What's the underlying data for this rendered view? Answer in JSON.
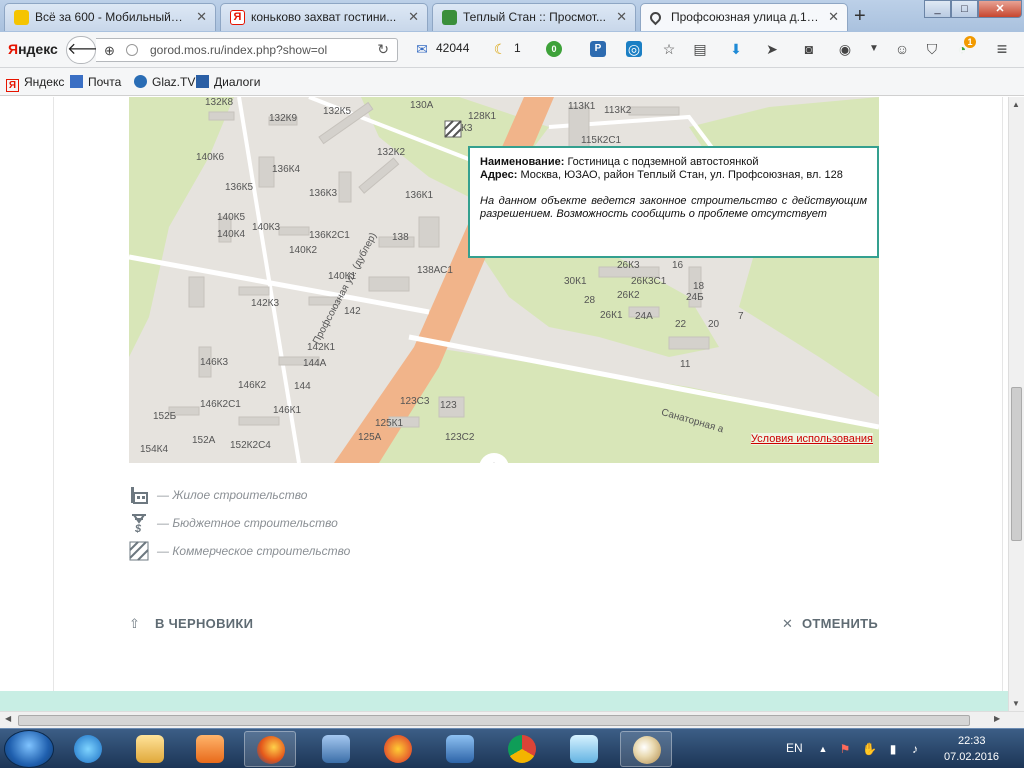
{
  "browser": {
    "tabs": [
      {
        "title": "Всё за 600 - Мобильный ...",
        "favicon_color": "#f5c400",
        "active": false
      },
      {
        "title": "коньково захват гостини...",
        "favicon_color": "#e61400",
        "active": false
      },
      {
        "title": "Теплый Стан :: Просмот...",
        "favicon_color": "#3a8f3a",
        "active": false
      },
      {
        "title": "Профсоюзная улица д.12...",
        "favicon_color": "#444444",
        "active": true
      }
    ],
    "new_tab_label": "+",
    "window_controls": {
      "minimize": "_",
      "maximize": "□",
      "close": "✕"
    },
    "brand": {
      "first": "Я",
      "rest": "ндекс"
    },
    "url": "gorod.mos.ru/index.php?show=ol",
    "mail_count": "42044",
    "moon_count": "1",
    "green_badge": "0",
    "sync_badge": "1"
  },
  "bookmarks": [
    {
      "label": "Яндекс",
      "icon": "yandex-icon",
      "color": "#e61400"
    },
    {
      "label": "Почта",
      "icon": "mail-icon",
      "color": "#3a6fc4"
    },
    {
      "label": "Glaz.TV",
      "icon": "tv-icon",
      "color": "#2a6db5"
    },
    {
      "label": "Диалоги",
      "icon": "chat-icon",
      "color": "#2a5fa5"
    }
  ],
  "map": {
    "labels": [
      "132К8",
      "132К9",
      "132К5",
      "130А",
      "128К1",
      "113К1",
      "113К2",
      "К3",
      "140К6",
      "136К4",
      "132К2",
      "115К2С1",
      "136К5",
      "136К3",
      "136К1",
      "140К5",
      "140К3",
      "136К2С1",
      "138",
      "140К4",
      "140К2",
      "140К1",
      "138АС1",
      "142К3",
      "142",
      "26К3",
      "30К1",
      "26К3С1",
      "26К2",
      "24Б",
      "28",
      "18",
      "26К1",
      "24А",
      "22",
      "20",
      "7",
      "16",
      "142К1",
      "146К3",
      "144А",
      "144",
      "146К2",
      "146К2С1",
      "146К1",
      "152Б",
      "152А",
      "152К2С4",
      "154К4",
      "123С3",
      "123",
      "125К1",
      "125А",
      "123С2",
      "11"
    ],
    "street_main": "Профсоюзная ул. (дублер)",
    "street_side": "Санаторная а",
    "terms_link": "Условия использования",
    "collapse_label": "︿"
  },
  "popup": {
    "name_label": "Наименование:",
    "name_value": "Гостиница с подземной автостоянкой",
    "address_label": "Адрес:",
    "address_value": "Москва, ЮЗАО, район Теплый Стан, ул. Профсоюзная, вл. 128",
    "note": "На данном объекте ведется законное строительство с действующим разрешением. Возможность сообщить о проблеме отсутствует"
  },
  "legend": [
    {
      "text": "— Жилое строительство",
      "icon": "residential-icon"
    },
    {
      "text": "— Бюджетное строительство",
      "icon": "budget-icon"
    },
    {
      "text": "— Коммерческое строительство",
      "icon": "commercial-icon"
    }
  ],
  "actions": {
    "drafts": "В ЧЕРНОВИКИ",
    "cancel": "ОТМЕНИТЬ"
  },
  "taskbar": {
    "language": "EN",
    "time": "22:33",
    "date": "07.02.2016"
  },
  "colors": {
    "popup_border": "#34a08f",
    "park": "#d8e6b8",
    "road": "#f1b48a",
    "terms_link": "#cc0000",
    "wave": "#c8eee4"
  }
}
